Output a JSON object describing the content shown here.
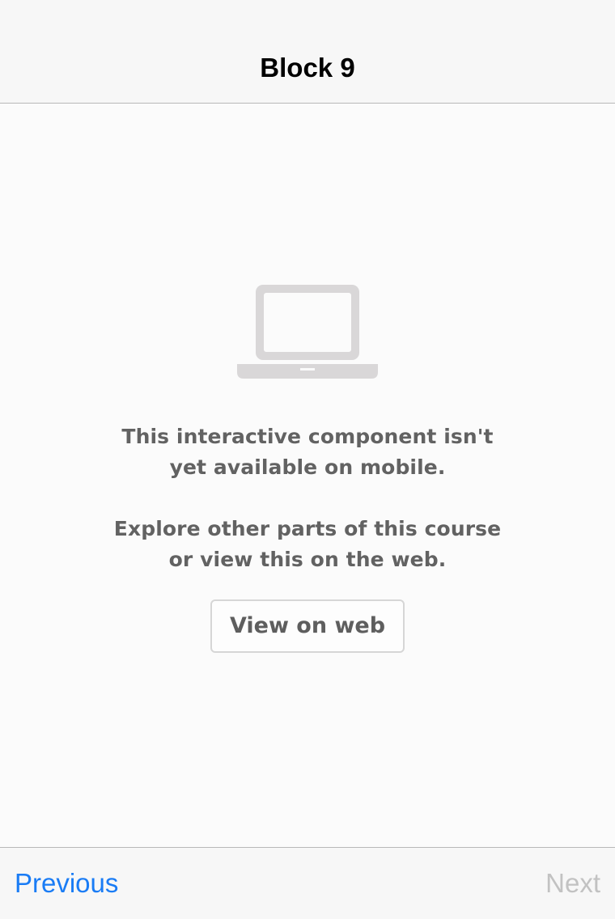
{
  "navbar": {
    "title": "Block 9"
  },
  "content": {
    "icon": "laptop-icon",
    "message_line1": "This interactive component isn't",
    "message_line2": "yet available on mobile.",
    "message_line3": "Explore other parts of this course",
    "message_line4": "or view this on the web.",
    "button_label": "View on web"
  },
  "toolbar": {
    "previous_label": "Previous",
    "next_label": "Next",
    "previous_color": "#1a7cf5",
    "next_color": "#c2c2c2",
    "next_disabled": true
  }
}
